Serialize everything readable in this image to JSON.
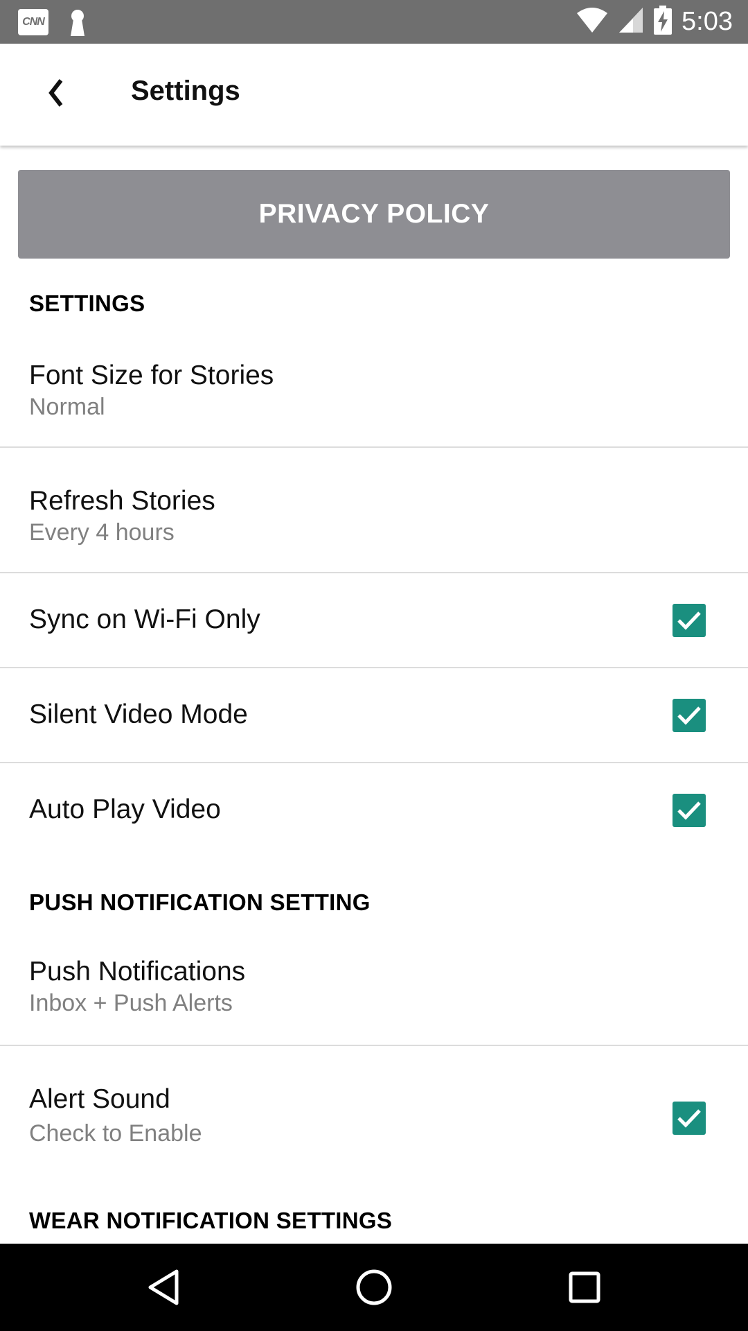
{
  "status_bar": {
    "time": "5:03",
    "icons": [
      "cnn-icon",
      "keyhole-icon",
      "wifi-icon",
      "signal-icon",
      "battery-charging-icon"
    ],
    "cnn_label": "CNN"
  },
  "app_bar": {
    "back_icon": "chevron-left-icon",
    "title": "Settings"
  },
  "privacy_button_label": "PRIVACY POLICY",
  "sections": {
    "settings_header": "SETTINGS",
    "push_header": "PUSH NOTIFICATION SETTING",
    "wear_header": "WEAR NOTIFICATION SETTINGS"
  },
  "rows": {
    "font_size": {
      "title": "Font Size for Stories",
      "subtitle": "Normal"
    },
    "refresh": {
      "title": "Refresh Stories",
      "subtitle": "Every 4 hours"
    },
    "sync_wifi": {
      "title": "Sync on Wi-Fi Only",
      "checked": true
    },
    "silent_video": {
      "title": "Silent Video Mode",
      "checked": true
    },
    "auto_play": {
      "title": "Auto Play Video",
      "checked": true
    },
    "push_notifications": {
      "title": "Push Notifications",
      "subtitle": "Inbox + Push Alerts"
    },
    "alert_sound": {
      "title": "Alert Sound",
      "subtitle": "Check to Enable",
      "checked": true
    }
  },
  "colors": {
    "status_bar": "#6f6f6f",
    "privacy_button": "#8e8e93",
    "checkbox": "#1a8f7f",
    "nav_bar": "#000000"
  },
  "nav_bar": {
    "icons": [
      "back-triangle-icon",
      "home-circle-icon",
      "recents-square-icon"
    ]
  }
}
